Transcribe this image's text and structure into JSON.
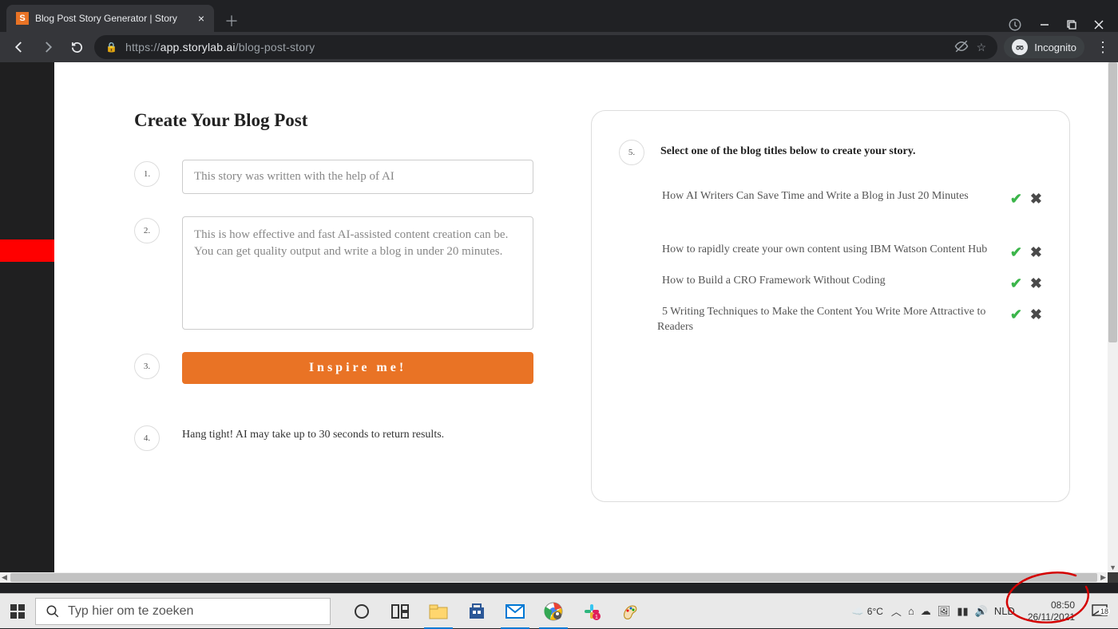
{
  "browser": {
    "tab_title": "Blog Post Story Generator | Story",
    "url_prefix": "https://",
    "url_host": "app.storylab.ai",
    "url_path": "/blog-post-story",
    "incognito_label": "Incognito"
  },
  "page": {
    "heading": "Create Your Blog Post",
    "steps": {
      "s1": {
        "num": "1.",
        "input_value": "This story was written with the help of AI"
      },
      "s2": {
        "num": "2.",
        "textarea_value": "This is how effective and fast AI-assisted content creation can be. You can get quality output and write a blog in under 20 minutes."
      },
      "s3": {
        "num": "3.",
        "button_label": "Inspire me!"
      },
      "s4": {
        "num": "4.",
        "text": "Hang tight! AI may take up to 30 seconds to return results."
      }
    },
    "right": {
      "num": "5.",
      "title": "Select one of the blog titles below to create your story.",
      "items": [
        " How AI Writers Can Save Time and Write a Blog in Just 20 Minutes",
        " How to rapidly create your own content using IBM Watson Content Hub",
        " How to Build a CRO Framework Without Coding",
        " 5 Writing Techniques to Make the Content You Write More Attractive to Readers"
      ]
    }
  },
  "taskbar": {
    "search_placeholder": "Typ hier om te zoeken",
    "weather_temp": "6°C",
    "lang": "NLD",
    "time": "08:50",
    "date": "26/11/2021",
    "notif_count": "18"
  }
}
